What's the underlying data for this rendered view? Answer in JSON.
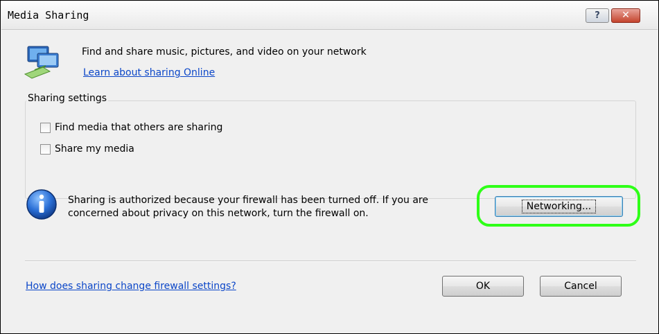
{
  "window": {
    "title": "Media Sharing",
    "help_button": "?",
    "close_button": "✕"
  },
  "header": {
    "description": "Find and share music, pictures, and video on your network",
    "learn_link": "Learn about sharing Online"
  },
  "sharing_settings": {
    "label": "Sharing settings",
    "options": [
      {
        "label": "Find media that others are sharing",
        "checked": false
      },
      {
        "label": "Share my media",
        "checked": false
      }
    ]
  },
  "info": {
    "message": "Sharing is authorized because your firewall has been turned off. If you are concerned about privacy on this network, turn the firewall on.",
    "networking_button": "Networking..."
  },
  "footer": {
    "help_link": "How does sharing change firewall settings?",
    "ok_button": "OK",
    "cancel_button": "Cancel"
  },
  "colors": {
    "link": "#0b46c8",
    "highlight": "#2fff18"
  }
}
